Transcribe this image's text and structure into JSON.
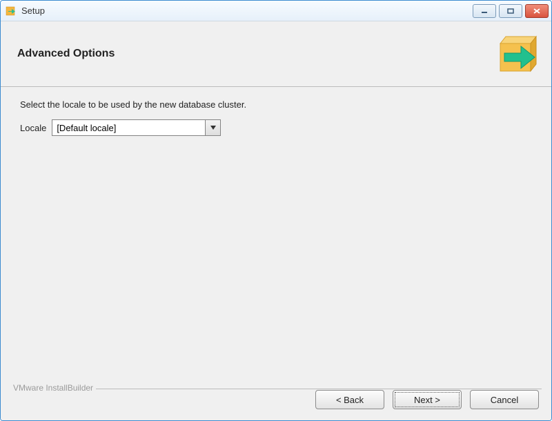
{
  "window": {
    "title": "Setup"
  },
  "header": {
    "title": "Advanced Options"
  },
  "content": {
    "description": "Select the locale to be used by the new database cluster.",
    "locale_label": "Locale",
    "locale_value": "[Default locale]"
  },
  "footer": {
    "brand": "VMware InstallBuilder",
    "back": "< Back",
    "next": "Next >",
    "cancel": "Cancel"
  }
}
